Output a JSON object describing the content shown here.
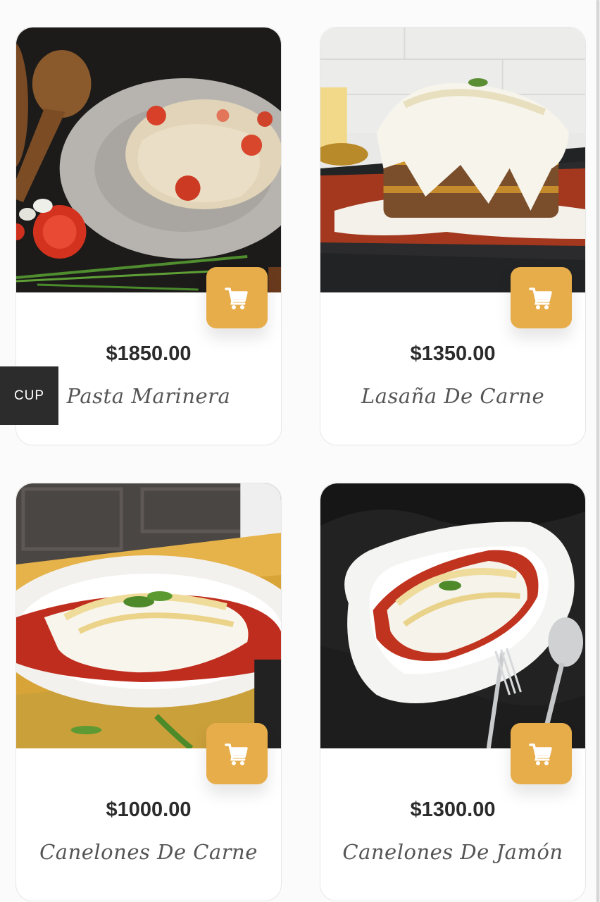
{
  "currency_switch": {
    "label": "CUP"
  },
  "products": [
    {
      "price": "$1850.00",
      "name": "Pasta Marinera"
    },
    {
      "price": "$1350.00",
      "name": "Lasaña De Carne"
    },
    {
      "price": "$1000.00",
      "name": "Canelones De Carne"
    },
    {
      "price": "$1300.00",
      "name": "Canelones De Jamón"
    }
  ],
  "colors": {
    "cart_button": "#e7ad4b",
    "price_text": "#2b2b2b",
    "name_text": "#555555",
    "badge_bg": "#2c2c2c"
  },
  "icons": {
    "cart": "shopping-cart-icon"
  }
}
